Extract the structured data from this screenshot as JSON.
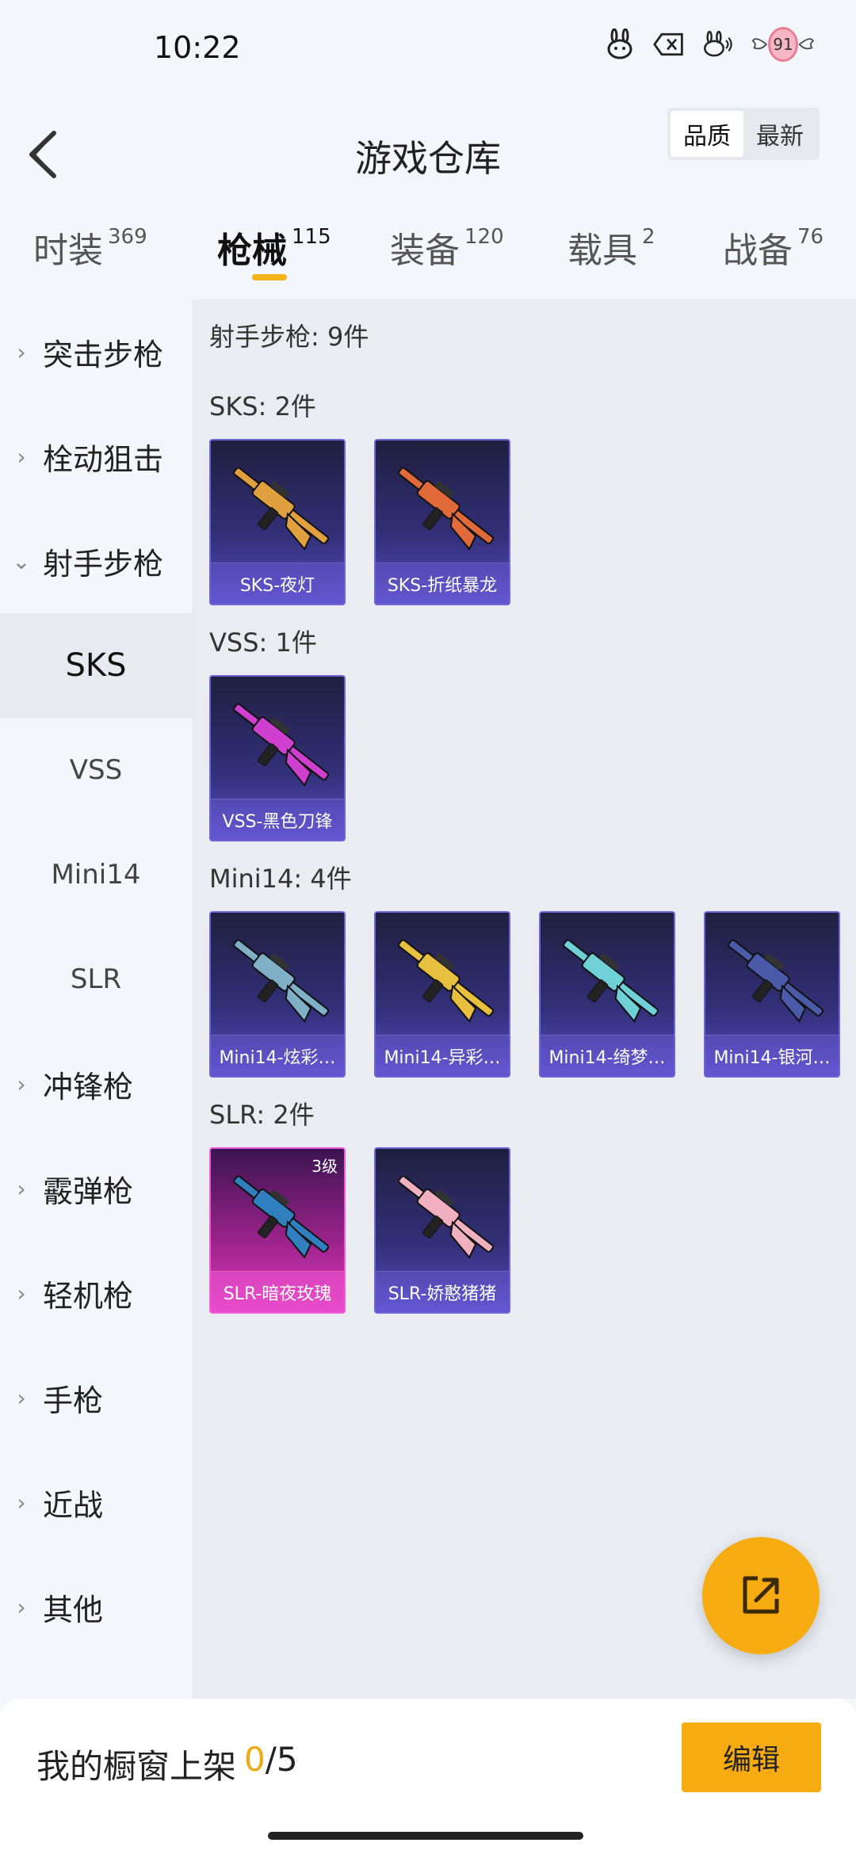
{
  "status": {
    "time": "10:22",
    "badge": "91"
  },
  "header": {
    "title": "游戏仓库",
    "sort_options": [
      "品质",
      "最新"
    ],
    "sort_active": "品质"
  },
  "tabs": [
    {
      "label": "时装",
      "count": "369"
    },
    {
      "label": "枪械",
      "count": "115"
    },
    {
      "label": "装备",
      "count": "120"
    },
    {
      "label": "载具",
      "count": "2"
    },
    {
      "label": "战备",
      "count": "76"
    }
  ],
  "sidebar": {
    "items": [
      {
        "label": "突击步枪",
        "expanded": false
      },
      {
        "label": "栓动狙击",
        "expanded": false
      },
      {
        "label": "射手步枪",
        "expanded": true
      },
      {
        "label": "冲锋枪",
        "expanded": false
      },
      {
        "label": "霰弹枪",
        "expanded": false
      },
      {
        "label": "轻机枪",
        "expanded": false
      },
      {
        "label": "手枪",
        "expanded": false
      },
      {
        "label": "近战",
        "expanded": false
      },
      {
        "label": "其他",
        "expanded": false
      }
    ],
    "subitems": [
      "SKS",
      "VSS",
      "Mini14",
      "SLR"
    ],
    "active_sub": "SKS"
  },
  "content": {
    "category_summary": "射手步枪: 9件",
    "groups": [
      {
        "heading": "SKS: 2件",
        "items": [
          {
            "name": "SKS-夜灯",
            "color": "#e0a040"
          },
          {
            "name": "SKS-折纸暴龙",
            "color": "#e06a3a"
          }
        ]
      },
      {
        "heading": "VSS: 1件",
        "items": [
          {
            "name": "VSS-黑色刀锋",
            "color": "#d040d0"
          }
        ]
      },
      {
        "heading": "Mini14: 4件",
        "items": [
          {
            "name": "Mini14-炫彩…",
            "color": "#7fb0c8"
          },
          {
            "name": "Mini14-异彩…",
            "color": "#e8c040"
          },
          {
            "name": "Mini14-绮梦…",
            "color": "#70d0d8"
          },
          {
            "name": "Mini14-银河…",
            "color": "#4a5aa8"
          }
        ]
      },
      {
        "heading": "SLR: 2件",
        "items": [
          {
            "name": "SLR-暗夜玫瑰",
            "color": "#3080c0",
            "level": "3级",
            "pink": true
          },
          {
            "name": "SLR-娇憨猪猪",
            "color": "#f0b0c0"
          }
        ]
      }
    ]
  },
  "bottom": {
    "label": "我的橱窗上架",
    "current": "0",
    "total": "/5",
    "edit": "编辑"
  },
  "colors": {
    "accent": "#f6ab10",
    "card_purple": "#33307a",
    "card_pink": "#e03ac2"
  }
}
